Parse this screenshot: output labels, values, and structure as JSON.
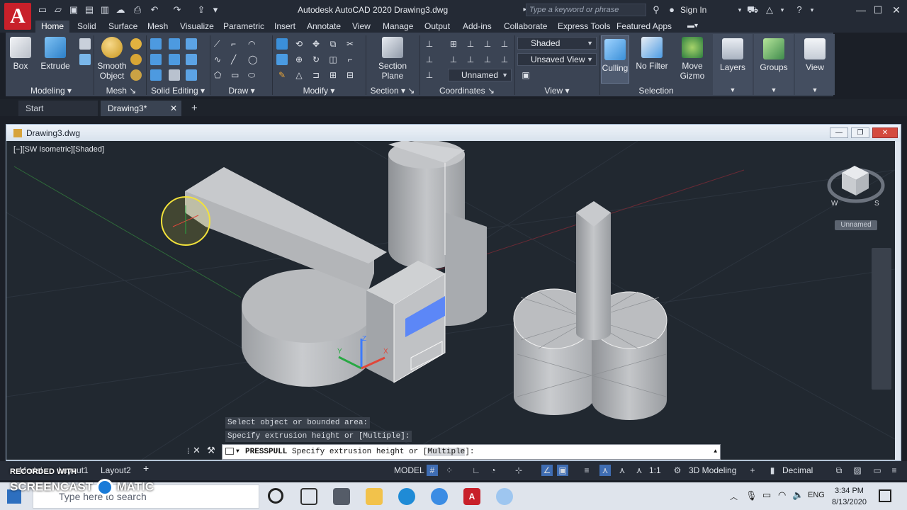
{
  "app": {
    "title": "Autodesk AutoCAD 2020   Drawing3.dwg",
    "search_placeholder": "Type a keyword or phrase",
    "sign_in": "Sign In"
  },
  "ribbon_tabs": [
    "Home",
    "Solid",
    "Surface",
    "Mesh",
    "Visualize",
    "Parametric",
    "Insert",
    "Annotate",
    "View",
    "Manage",
    "Output",
    "Add-ins",
    "Collaborate",
    "Express Tools",
    "Featured Apps"
  ],
  "ribbon": {
    "modeling": {
      "title": "Modeling",
      "box": "Box",
      "extrude": "Extrude"
    },
    "mesh": {
      "title": "Mesh",
      "smooth1": "Smooth",
      "smooth2": "Object"
    },
    "solid_editing": {
      "title": "Solid Editing"
    },
    "draw": {
      "title": "Draw"
    },
    "modify": {
      "title": "Modify"
    },
    "section": {
      "title": "Section",
      "plane1": "Section",
      "plane2": "Plane"
    },
    "coordinates": {
      "title": "Coordinates",
      "ucs_name": "Unnamed"
    },
    "view": {
      "title": "View",
      "visual_style": "Shaded",
      "saved_view": "Unsaved View"
    },
    "selection": {
      "title": "Selection",
      "culling": "Culling",
      "filter": "No Filter",
      "gizmo1": "Move",
      "gizmo2": "Gizmo"
    },
    "layers": "Layers",
    "groups": "Groups",
    "view_btn": "View"
  },
  "file_tabs": {
    "start": "Start",
    "drawing": "Drawing3*"
  },
  "document": {
    "title": "Drawing3.dwg",
    "viewport_label": "[−][SW Isometric][Shaded]",
    "viewcube_label": "Unnamed",
    "viewcube_w": "W",
    "viewcube_s": "S",
    "ucs_x": "X",
    "ucs_y": "Y",
    "ucs_z": "Z"
  },
  "command": {
    "history1": "Select object or bounded area:",
    "history2": "Specify extrusion height or [Multiple]:",
    "current_cmd": "PRESSPULL",
    "current_prefix": "Specify extrusion height or [",
    "current_option": "Multiple",
    "current_suffix": "]:"
  },
  "layout_tabs": [
    "Model",
    "Layout1",
    "Layout2"
  ],
  "status": {
    "model": "MODEL",
    "scale": "1:1",
    "workspace": "3D Modeling",
    "units": "Decimal"
  },
  "taskbar": {
    "search_placeholder": "Type here to search",
    "time": "3:34 PM",
    "date": "8/13/2020",
    "lang": "ENG"
  },
  "watermark": {
    "line1": "RECORDED WITH",
    "line2": "SCREENCAST",
    "line3": "MATIC"
  },
  "colors": {
    "accent": "#3b4454",
    "logo": "#c8202a",
    "canvas": "#212830",
    "highlight": "#4a7cff"
  }
}
